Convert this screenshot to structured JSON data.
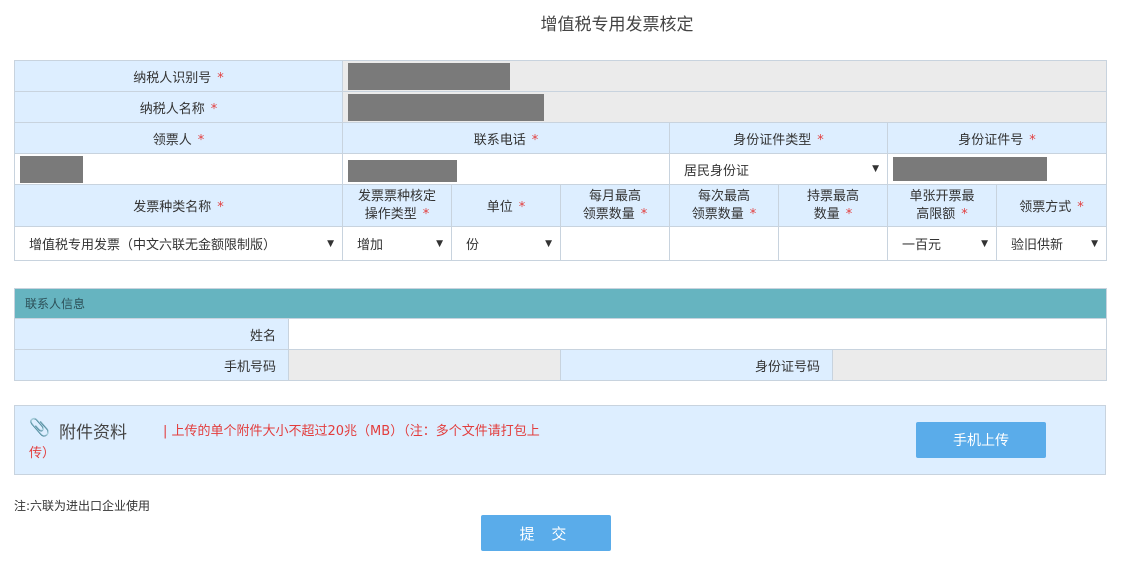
{
  "page": {
    "title": "增值税专用发票核定"
  },
  "required_mark": "*",
  "taxpayer": {
    "id_label": "纳税人识别号",
    "name_label": "纳税人名称"
  },
  "recipient": {
    "person_label": "领票人",
    "phone_label": "联系电话",
    "id_type_label": "身份证件类型",
    "id_type_value": "居民身份证",
    "id_number_label": "身份证件号"
  },
  "invoice": {
    "type_label": "发票种类名称",
    "op_type_label_1": "发票票种核定",
    "op_type_label_2": "操作类型",
    "unit_label": "单位",
    "monthly_max_1": "每月最高",
    "monthly_max_2": "领票数量",
    "each_max_1": "每次最高",
    "each_max_2": "领票数量",
    "hold_max_1": "持票最高",
    "hold_max_2": "数量",
    "single_limit_1": "单张开票最",
    "single_limit_2": "高限额",
    "method_label": "领票方式",
    "type_value": "增值税专用发票（中文六联无金额限制版）",
    "op_type_value": "增加",
    "unit_value": "份",
    "single_limit_value": "一百元",
    "method_value": "验旧供新"
  },
  "contact": {
    "header": "联系人信息",
    "name_label": "姓名",
    "mobile_label": "手机号码",
    "idno_label": "身份证号码"
  },
  "attachment": {
    "title": "附件资料",
    "note": "| 上传的单个附件大小不超过20兆（MB）（注：多个文件请打包上传）",
    "upload_button": "手机上传"
  },
  "footnote": "注:六联为进出口企业使用",
  "submit_button": "提 交",
  "icons": {
    "dropdown": "caret-down-icon",
    "attach": "paperclip-icon"
  }
}
